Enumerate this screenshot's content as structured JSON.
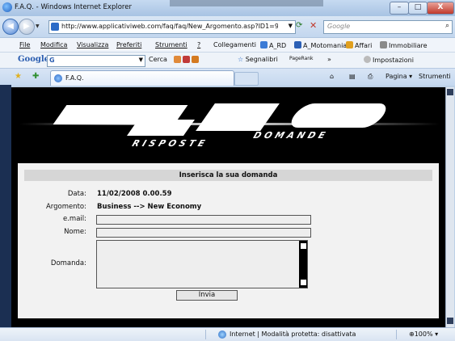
{
  "window": {
    "title": "F.A.Q. - Windows Internet Explorer",
    "min_label": "–",
    "max_label": "□",
    "close_label": "X"
  },
  "nav": {
    "url": "http://www.applicativiweb.com/faq/faq/New_Argomento.asp?ID1=9",
    "search_placeholder": "Google"
  },
  "menu": {
    "items": [
      "File",
      "Modifica",
      "Visualizza",
      "Preferiti",
      "Strumenti",
      "?"
    ]
  },
  "links": {
    "items": [
      "Collegamenti",
      "A_RD",
      "A_Motomania",
      "Affari",
      "Immobiliare"
    ]
  },
  "google_toolbar": {
    "logo": "Google",
    "box_value": "G",
    "cerca": "Cerca",
    "segnalibri": "Segnalibri",
    "pagerank": "PageRank",
    "impostazioni": "Impostazioni"
  },
  "tabs": {
    "active": "F.A.Q.",
    "pagina": "Pagina",
    "strumenti": "Strumenti"
  },
  "banner": {
    "big": "FAQ",
    "domande": "DOMANDE",
    "risposte": "RISPOSTE"
  },
  "form": {
    "heading": "Inserisca la sua domanda",
    "data_label": "Data:",
    "data_value": "11/02/2008 0.00.59",
    "argomento_label": "Argomento:",
    "argomento_value": "Business --> New Economy",
    "email_label": "e.mail:",
    "nome_label": "Nome:",
    "domanda_label": "Domanda:",
    "submit_label": "Invia"
  },
  "status": {
    "zone": "Internet | Modalità protetta: disattivata",
    "zoom": "100%"
  }
}
